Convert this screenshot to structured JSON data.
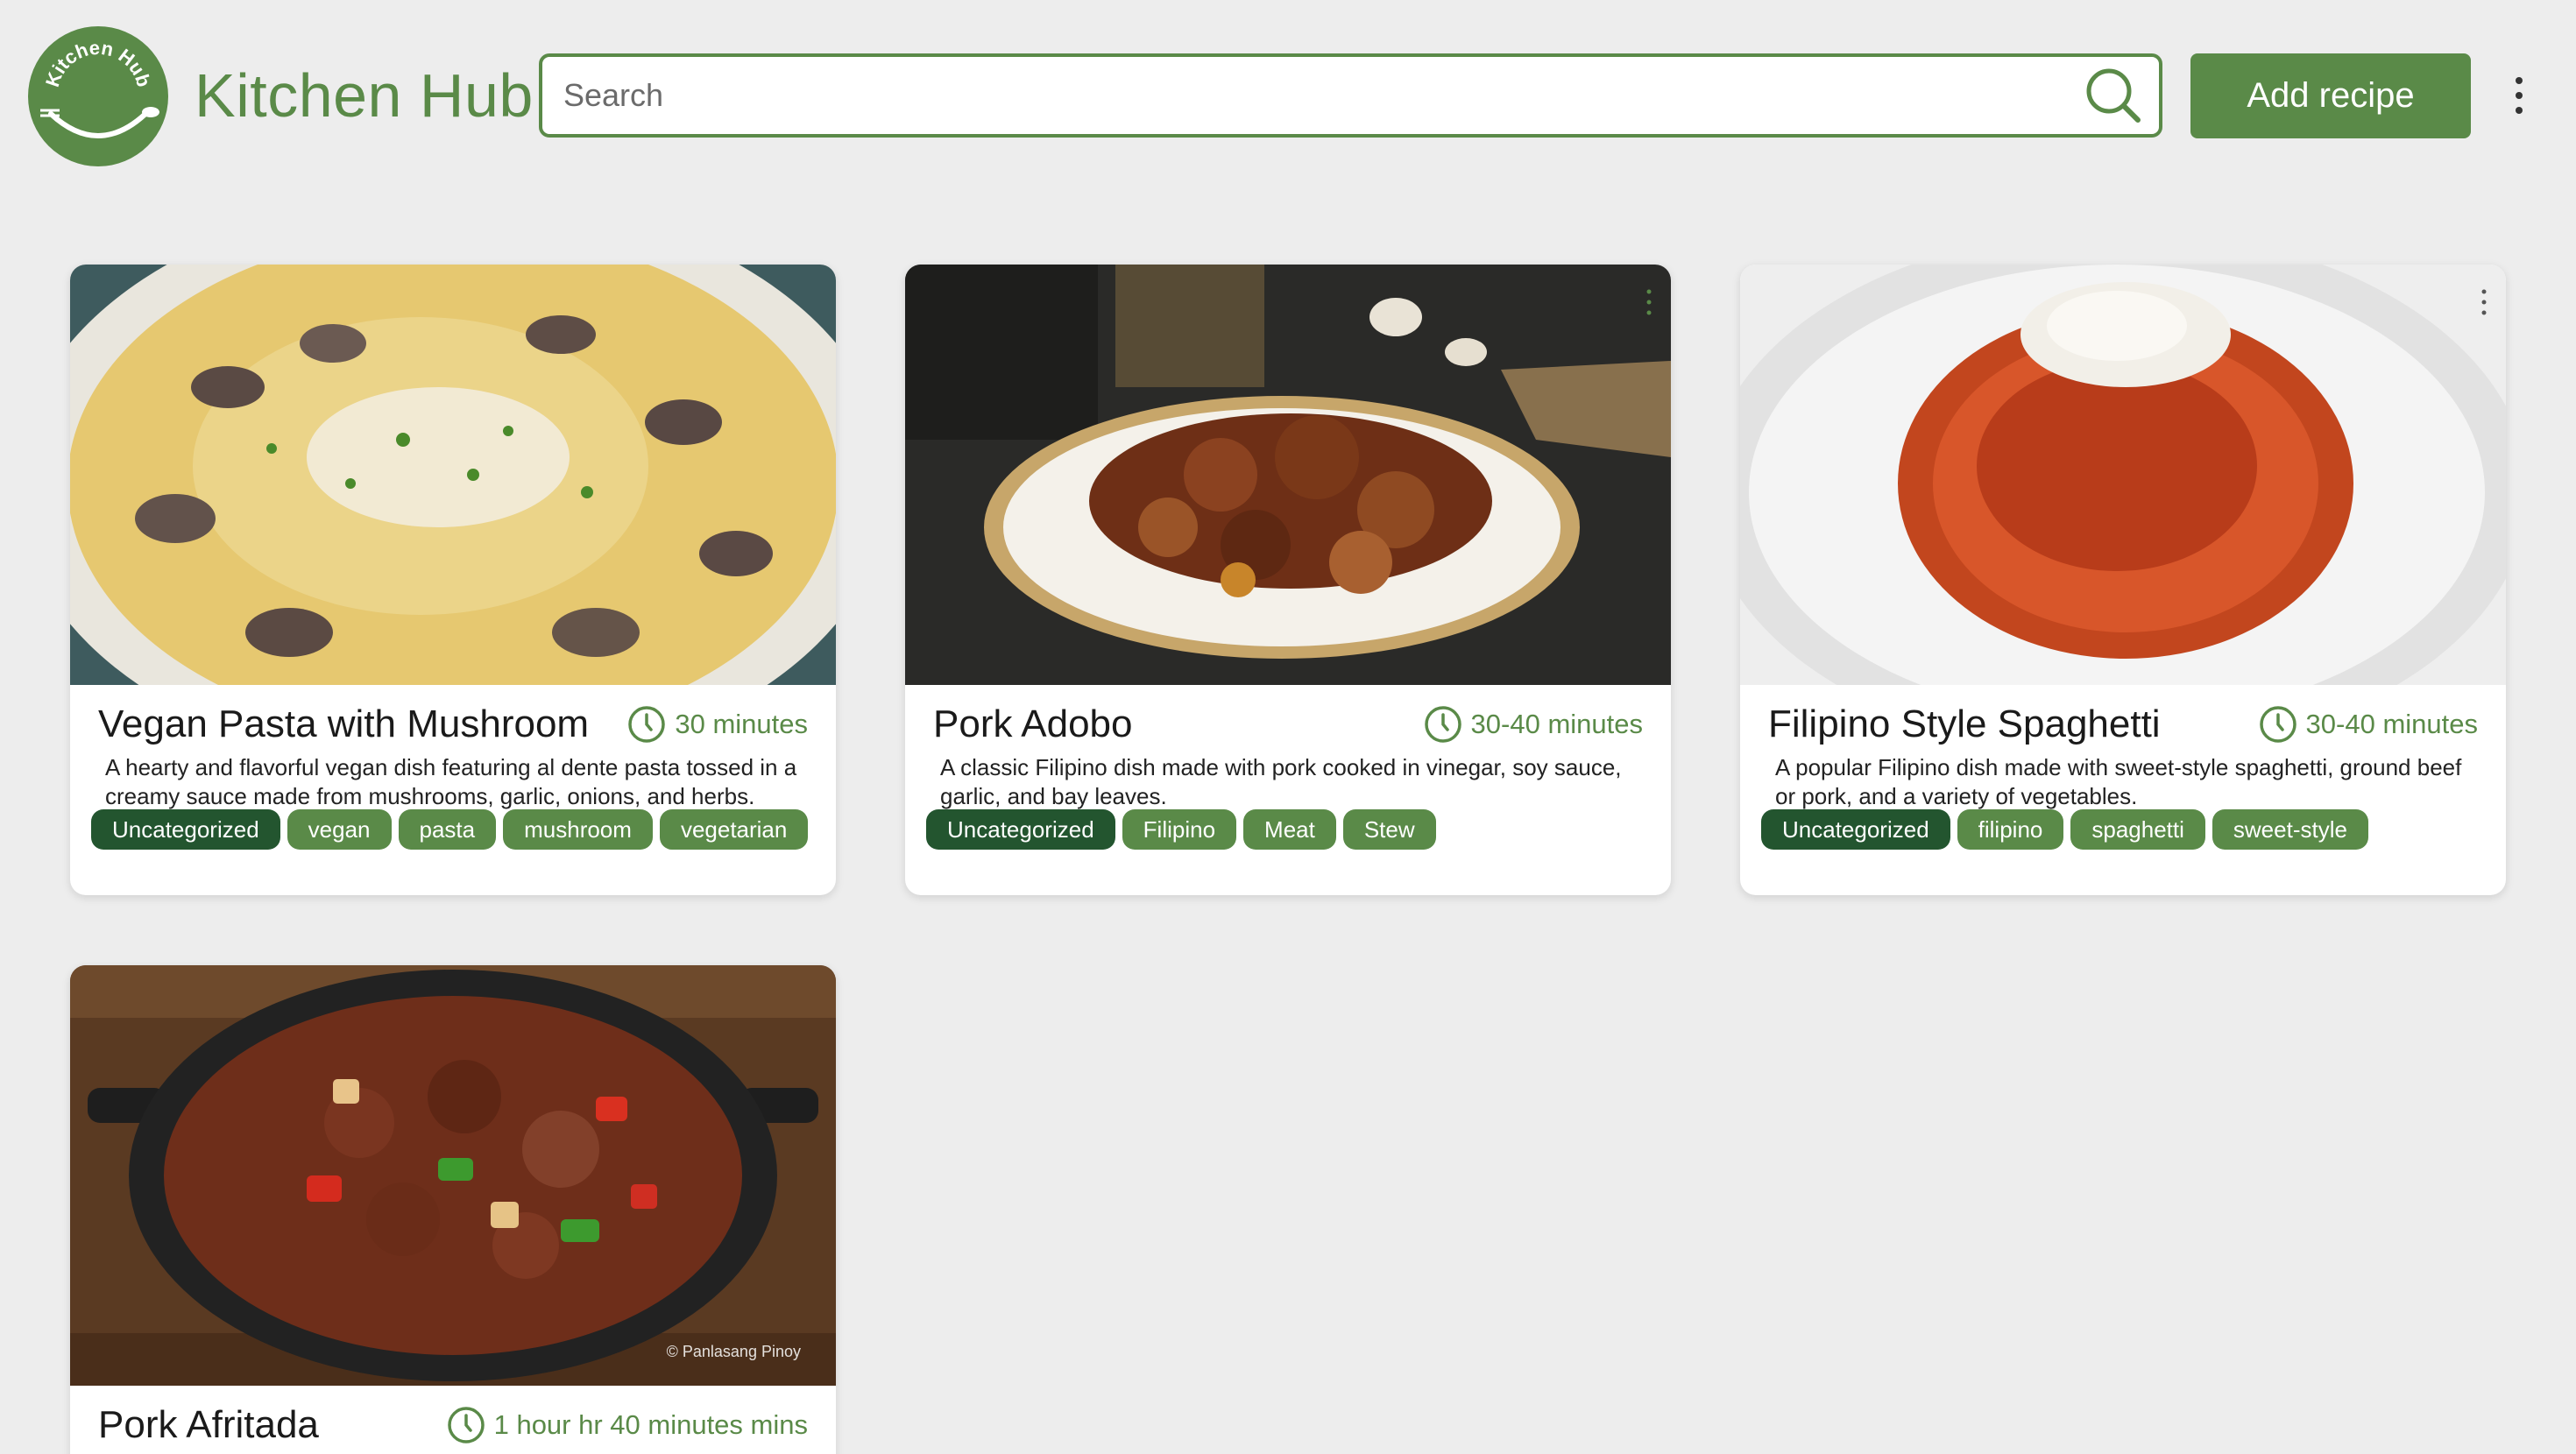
{
  "app": {
    "title": "Kitchen Hub",
    "logo_text": "Kitchen Hub",
    "brand_color": "#5a8a48",
    "dark_tag_color": "#23552f"
  },
  "search": {
    "placeholder": "Search",
    "value": ""
  },
  "toolbar": {
    "add_label": "Add recipe"
  },
  "recipes": [
    {
      "title": "Vegan Pasta with Mushroom",
      "time": "30 minutes",
      "description": "A hearty and flavorful vegan dish featuring al dente pasta tossed in a creamy sauce made from mushrooms, garlic, onions, and herbs.",
      "tags": [
        "Uncategorized",
        "vegan",
        "pasta",
        "mushroom",
        "vegetarian"
      ]
    },
    {
      "title": "Pork Adobo",
      "time": "30-40 minutes",
      "description": "A classic Filipino dish made with pork cooked in vinegar, soy sauce, garlic, and bay leaves.",
      "tags": [
        "Uncategorized",
        "Filipino",
        "Meat",
        "Stew"
      ]
    },
    {
      "title": "Filipino Style Spaghetti",
      "time": "30-40 minutes",
      "description": "A popular Filipino dish made with sweet-style spaghetti, ground beef or pork, and a variety of vegetables.",
      "tags": [
        "Uncategorized",
        "filipino",
        "spaghetti",
        "sweet-style"
      ]
    },
    {
      "title": "Pork Afritada",
      "time": "1 hour hr 40 minutes mins",
      "photo_credit": "© Panlasang Pinoy"
    }
  ]
}
